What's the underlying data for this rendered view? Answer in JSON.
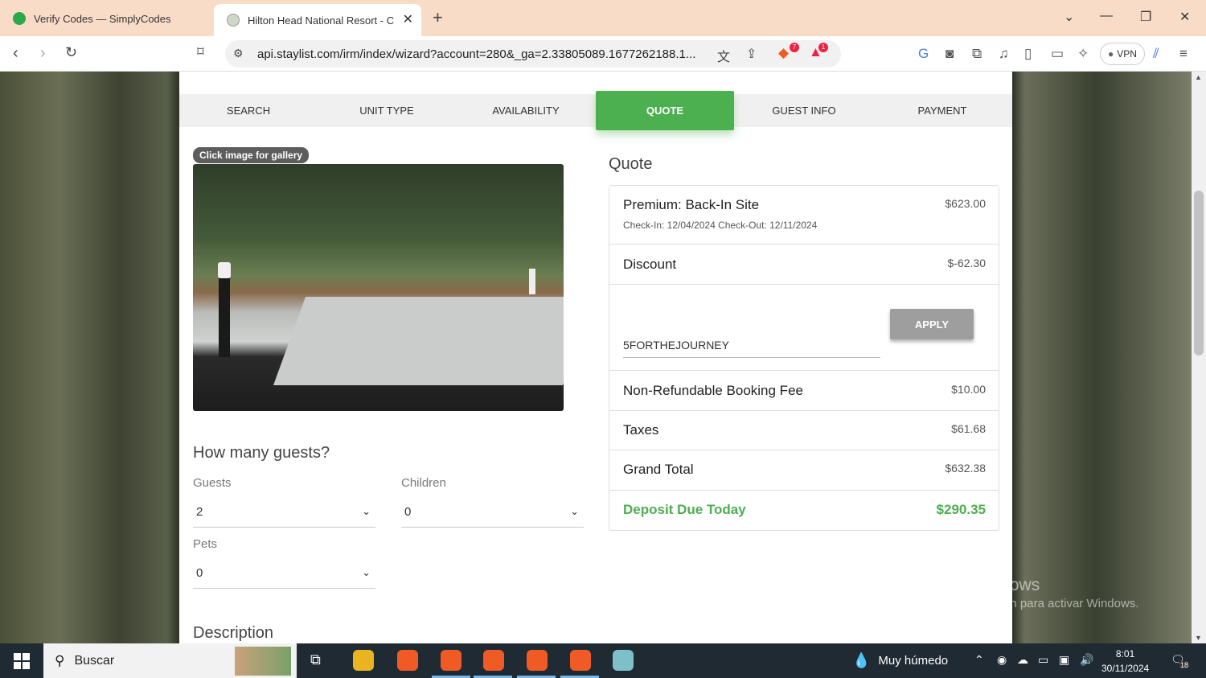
{
  "browser": {
    "tabs": [
      {
        "title": "Verify Codes — SimplyCodes"
      },
      {
        "title": "Hilton Head National Resort - C"
      }
    ],
    "url": "api.staylist.com/irm/index/wizard?account=280&_ga=2.33805089.1677262188.1...",
    "brave_badge": "7",
    "rewards_badge": "1",
    "vpn_label": "VPN"
  },
  "steps": [
    {
      "label": "SEARCH"
    },
    {
      "label": "UNIT TYPE"
    },
    {
      "label": "AVAILABILITY"
    },
    {
      "label": "QUOTE",
      "active": true
    },
    {
      "label": "GUEST INFO"
    },
    {
      "label": "PAYMENT"
    }
  ],
  "gallery": {
    "label": "Click image for gallery"
  },
  "guests": {
    "title": "How many guests?",
    "guests_label": "Guests",
    "guests_value": "2",
    "children_label": "Children",
    "children_value": "0",
    "pets_label": "Pets",
    "pets_value": "0"
  },
  "description_title": "Description",
  "quote": {
    "title": "Quote",
    "site_name": "Premium: Back-In Site",
    "site_amount": "$623.00",
    "dates": "Check-In: 12/04/2024 Check-Out: 12/11/2024",
    "discount_label": "Discount",
    "discount_amount": "$-62.30",
    "promo_code": "5FORTHEJOURNEY",
    "apply_label": "APPLY",
    "fee_label": "Non-Refundable Booking Fee",
    "fee_amount": "$10.00",
    "taxes_label": "Taxes",
    "taxes_amount": "$61.68",
    "total_label": "Grand Total",
    "total_amount": "$632.38",
    "deposit_label": "Deposit Due Today",
    "deposit_amount": "$290.35"
  },
  "watermark": {
    "line1": "Activar Windows",
    "line2": "Ve a Configuración para activar Windows."
  },
  "taskbar": {
    "search_text": "Buscar",
    "weather": "Muy húmedo",
    "time": "8:01",
    "date": "30/11/2024",
    "notifications": "18"
  }
}
